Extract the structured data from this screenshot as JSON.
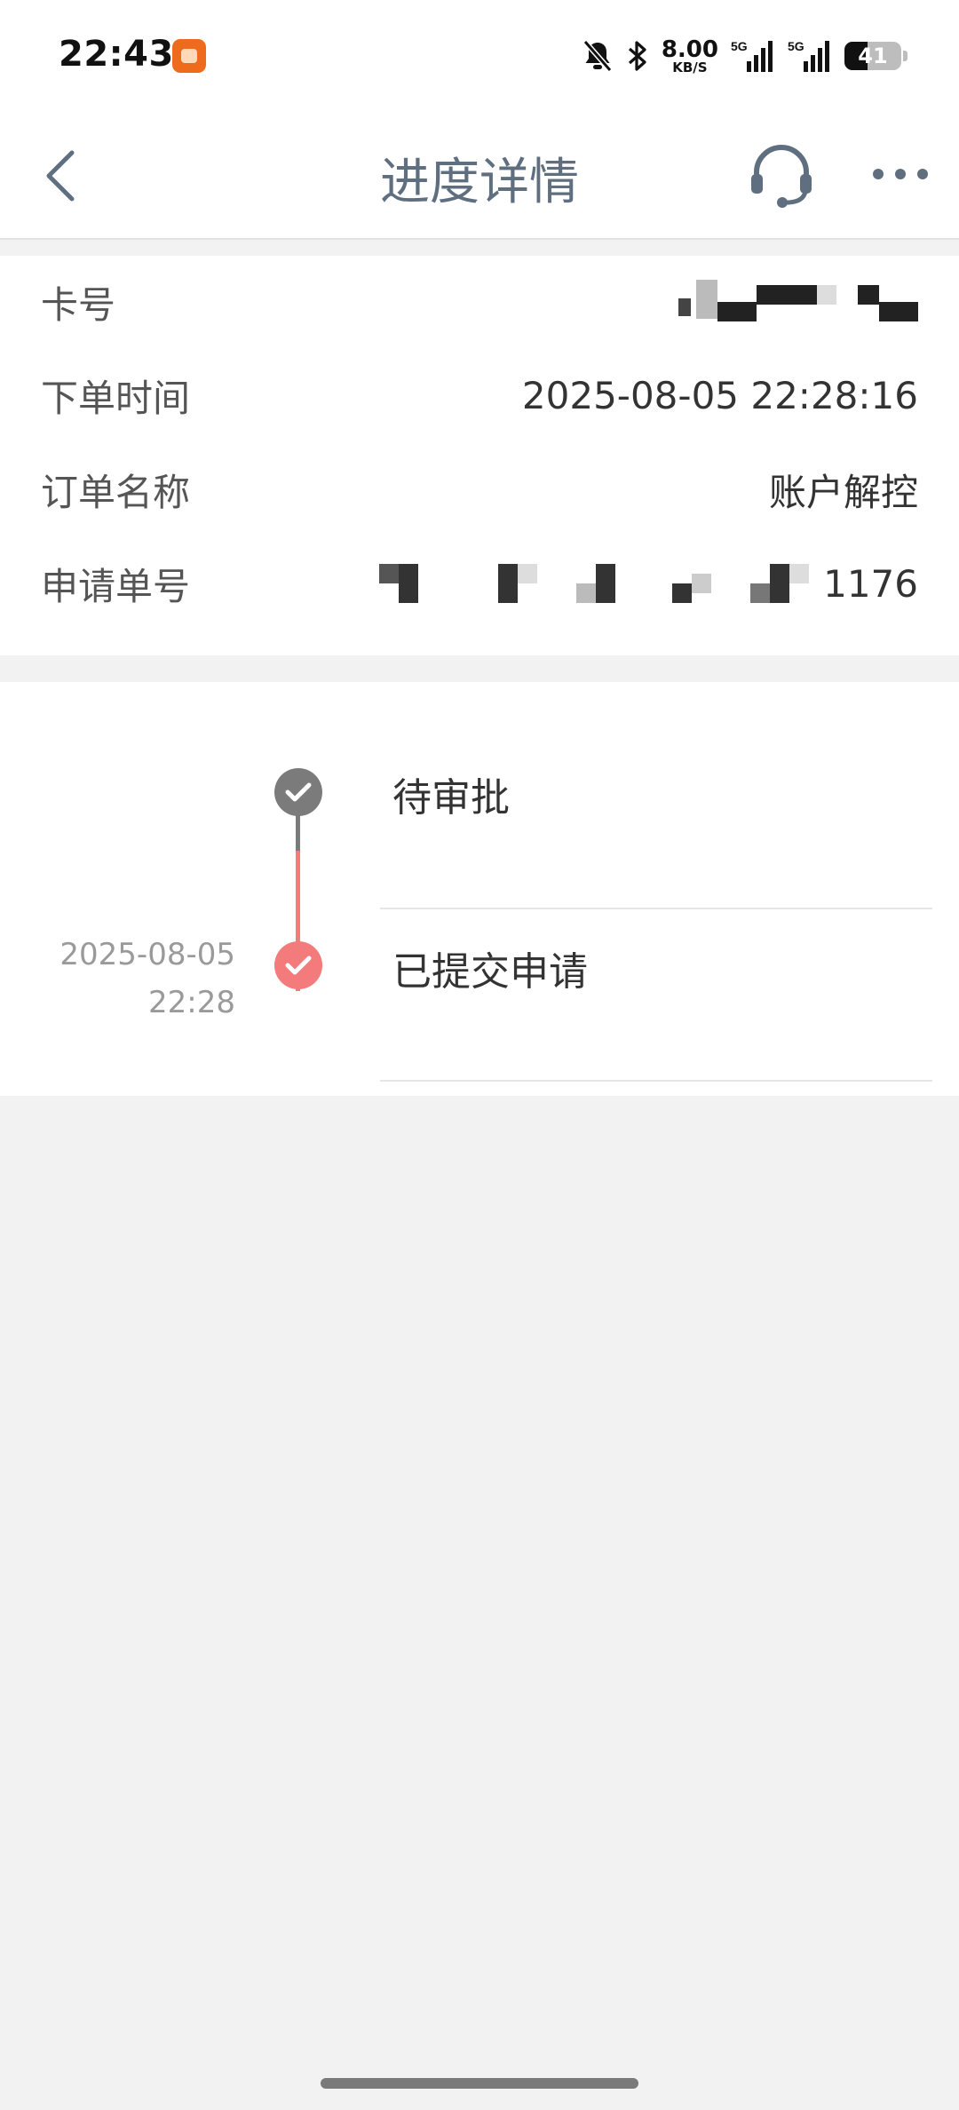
{
  "status_bar": {
    "time": "22:43",
    "net_speed_value": "8.00",
    "net_speed_unit": "KB/S",
    "signal_1_label": "5G",
    "signal_2_label": "5G",
    "battery_level": "41",
    "icons": [
      "orange-app-icon",
      "silent-bell-icon",
      "bluetooth-icon",
      "signal-icon",
      "signal-icon",
      "battery-icon"
    ]
  },
  "nav": {
    "title": "进度详情",
    "icons": [
      "back-arrow-icon",
      "headset-icon",
      "more-dots-icon"
    ]
  },
  "info": {
    "card_no": {
      "label": "卡号",
      "value": ""
    },
    "order_time": {
      "label": "下单时间",
      "value": "2025-08-05 22:28:16"
    },
    "order_name": {
      "label": "订单名称",
      "value": "账户解控"
    },
    "apply_no": {
      "label": "申请单号",
      "value": "1176"
    }
  },
  "timeline": [
    {
      "title": "待审批",
      "date": "",
      "time": "",
      "status": "pending"
    },
    {
      "title": "已提交申请",
      "date": "2025-08-05",
      "time": "22:28",
      "status": "done"
    }
  ],
  "colors": {
    "accent": "#f47b7b",
    "node_gray": "#7b7b7b",
    "title": "#5f6f80",
    "page_bg": "#f2f2f2"
  }
}
